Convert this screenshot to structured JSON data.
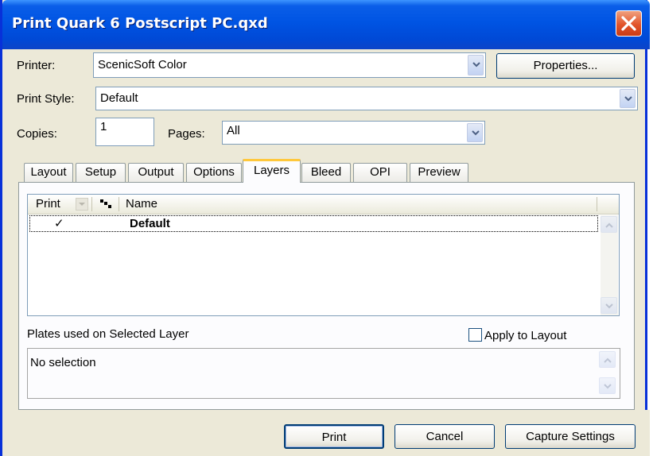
{
  "window": {
    "title": "Print Quark 6 Postscript PC.qxd"
  },
  "printer": {
    "label": "Printer:",
    "value": "ScenicSoft Color",
    "properties_button": "Properties..."
  },
  "print_style": {
    "label": "Print Style:",
    "value": "Default"
  },
  "copies": {
    "label": "Copies:",
    "value": "1"
  },
  "pages": {
    "label": "Pages:",
    "value": "All"
  },
  "tabs": [
    {
      "label": "Layout",
      "active": false
    },
    {
      "label": "Setup",
      "active": false
    },
    {
      "label": "Output",
      "active": false
    },
    {
      "label": "Options",
      "active": false
    },
    {
      "label": "Layers",
      "active": true
    },
    {
      "label": "Bleed",
      "active": false
    },
    {
      "label": "OPI",
      "active": false
    },
    {
      "label": "Preview",
      "active": false
    }
  ],
  "layers_table": {
    "columns": [
      "Print",
      "",
      "Name"
    ],
    "rows": [
      {
        "print": "✓",
        "name": "Default"
      }
    ]
  },
  "plates": {
    "label": "Plates used on Selected Layer",
    "apply_to_layout_label": "Apply to Layout",
    "apply_to_layout_checked": false,
    "content": "No selection"
  },
  "buttons": {
    "print": "Print",
    "cancel": "Cancel",
    "capture_settings": "Capture Settings"
  },
  "colors": {
    "title_bar": "#0054e3",
    "dialog_bg": "#ece9d8",
    "active_tab_accent": "#ffc83c",
    "close_button": "#e2542b"
  }
}
